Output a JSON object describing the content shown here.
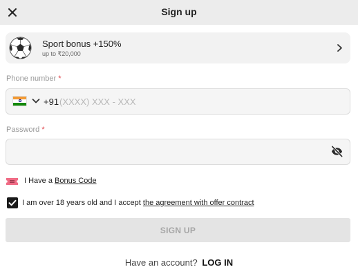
{
  "header": {
    "title": "Sign up",
    "close_icon": "close-icon"
  },
  "bonus": {
    "title": "Sport bonus +150%",
    "subtitle": "up to ₹20,000",
    "icon": "soccer-ball-icon",
    "chevron_icon": "chevron-right-icon"
  },
  "phone": {
    "label": "Phone number",
    "required_mark": "*",
    "country_flag": "india-flag-icon",
    "dropdown_icon": "chevron-down-icon",
    "prefix": "+91",
    "value": "",
    "placeholder": "(XXXX) XXX - XXX"
  },
  "password": {
    "label": "Password",
    "required_mark": "*",
    "value": "",
    "placeholder": "",
    "visibility_icon": "eye-off-icon"
  },
  "bonus_code": {
    "prefix": "I Have a",
    "link": "Bonus Code",
    "icon": "ticket-icon"
  },
  "agreement": {
    "checked": true,
    "text": "I am over 18 years old and I accept",
    "link": "the agreement with offer contract"
  },
  "submit": {
    "label": "SIGN UP"
  },
  "footer": {
    "question": "Have an account?",
    "login_label": "LOG IN"
  },
  "colors": {
    "header_bg": "#ececec",
    "required": "#e0454b",
    "disabled_button_bg": "#e4e4e4",
    "disabled_button_text": "#a6a6a6",
    "ticket": "#f06b85"
  }
}
